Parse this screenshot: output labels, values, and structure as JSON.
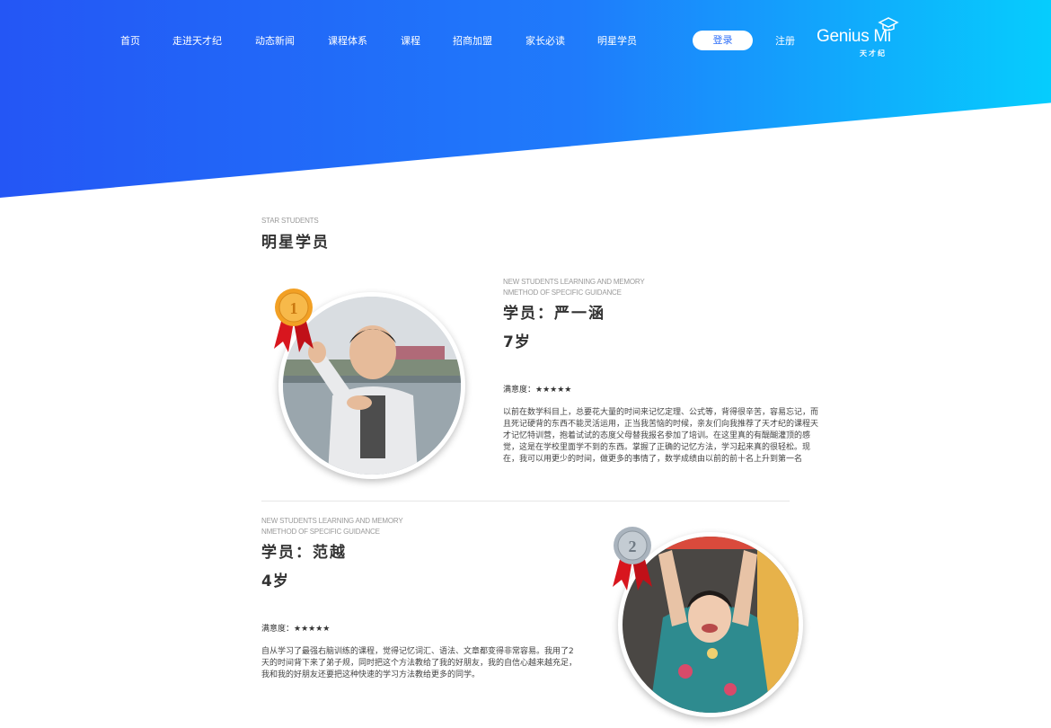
{
  "nav": {
    "items": [
      "首页",
      "走进天才纪",
      "动态新闻",
      "课程体系",
      "课程",
      "招商加盟",
      "家长必读",
      "明星学员"
    ],
    "login_label": "登录",
    "register_label": "注册",
    "logo_text": "Genius Mi",
    "logo_sub": "天才纪"
  },
  "section": {
    "en_title": "STAR STUDENTS",
    "title": "明星学员"
  },
  "students": [
    {
      "en_line1": "NEW STUDENTS LEARNING AND MEMORY",
      "en_line2": "NMETHOD OF SPECIFIC GUIDANCE",
      "name": "学员：严一涵",
      "age": "7岁",
      "rating": "满意度：★★★★★",
      "medal": "1",
      "description": "以前在数学科目上，总要花大量的时间来记忆定理、公式等，背得很辛苦，容易忘记，而且死记硬背的东西不能灵活运用，正当我苦恼的时候，亲友们向我推荐了天才纪的课程天才记忆特训营，抱着试试的态度父母替我报名参加了培训。在这里真的有醍醐灌顶的感觉，这是在学校里面学不到的东西。掌握了正确的记忆方法，学习起来真的很轻松。现在，我可以用更少的时间，做更多的事情了，数学成绩由以前的前十名上升到第一名"
    },
    {
      "en_line1": "NEW STUDENTS LEARNING AND MEMORY",
      "en_line2": "NMETHOD OF SPECIFIC GUIDANCE",
      "name": "学员：范越",
      "age": "4岁",
      "rating": "满意度：★★★★★",
      "medal": "2",
      "description": "自从学习了最强右脑训练的课程，觉得记忆词汇、语法、文章都变得非常容易。我用了2天的时间背下来了弟子规，同时把这个方法教给了我的好朋友，我的自信心越来越充足，我和我的好朋友还要把这种快速的学习方法教给更多的同学。"
    }
  ],
  "colors": {
    "gradient_start": "#2456f5",
    "gradient_end": "#06cdfd",
    "gold_medal": "#f2a024",
    "silver_medal": "#a9b3bd",
    "ribbon": "#d8161e"
  }
}
